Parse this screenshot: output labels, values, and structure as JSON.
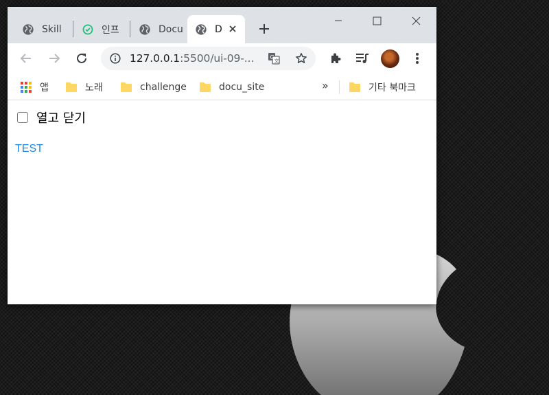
{
  "browser": {
    "tabs": [
      {
        "label": "Skill",
        "icon": "globe-icon"
      },
      {
        "label": "인프",
        "icon": "inflearn-icon"
      },
      {
        "label": "Docu",
        "icon": "globe-icon"
      },
      {
        "label": "D",
        "icon": "globe-icon",
        "active": true
      }
    ],
    "address": {
      "host": "127.0.0.1",
      "rest": ":5500/ui-09-..."
    },
    "bookmarks": [
      {
        "label": "앱",
        "icon": "apps-grid-icon"
      },
      {
        "label": "노래",
        "icon": "folder-icon"
      },
      {
        "label": "challenge",
        "icon": "folder-icon"
      },
      {
        "label": "docu_site",
        "icon": "folder-icon"
      }
    ],
    "bookmarks_more": "»",
    "other_bookmarks": "기타 북마크"
  },
  "page": {
    "checkbox_label": "열고 닫기",
    "checkbox_checked": false,
    "test_link": "TEST"
  },
  "colors": {
    "link": "#1e88e5",
    "titlebar": "#dee1e6",
    "folder": "#fdd663"
  }
}
